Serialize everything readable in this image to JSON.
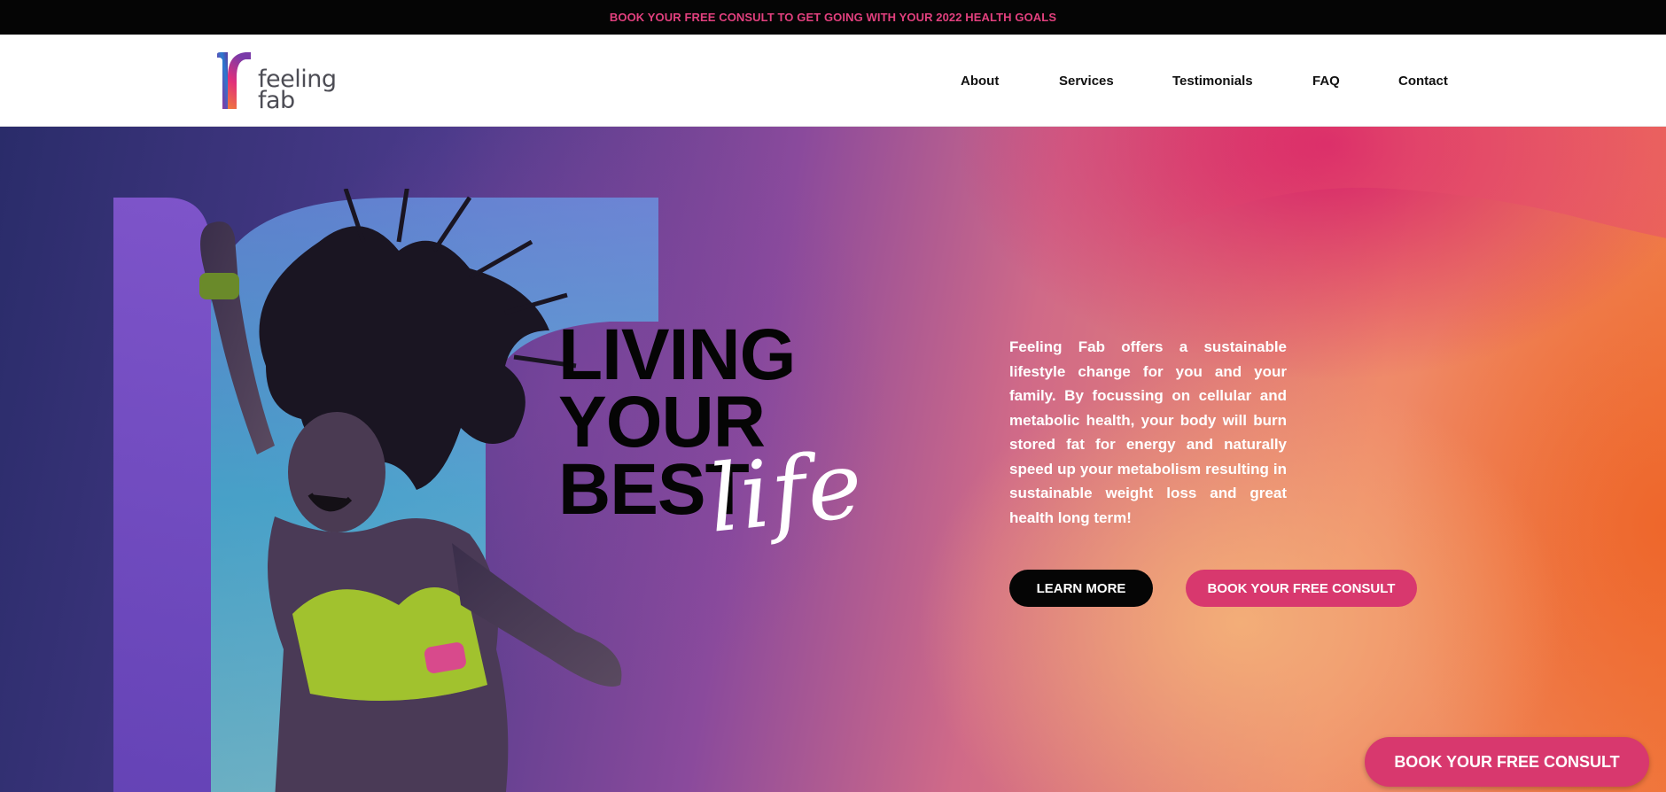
{
  "topbar": {
    "text": "BOOK YOUR FREE CONSULT TO GET GOING WITH YOUR 2022 HEALTH GOALS"
  },
  "brand": {
    "line1": "feeling",
    "line2": "fab"
  },
  "nav": {
    "items": [
      {
        "label": "About"
      },
      {
        "label": "Services"
      },
      {
        "label": "Testimonials"
      },
      {
        "label": "FAQ"
      },
      {
        "label": "Contact"
      }
    ]
  },
  "hero": {
    "headline_1": "LIVING",
    "headline_2": "YOUR",
    "headline_3": "BEST",
    "script": "life",
    "paragraph": "Feeling Fab offers a sustainable lifestyle change for you and your family. By focussing on cellular and metabolic health, your body will burn stored fat for energy and naturally speed up your metabolism resulting in sustainable weight loss and great health long term!",
    "learn_more_label": "LEARN MORE",
    "consult_label": "BOOK YOUR FREE CONSULT"
  },
  "floating": {
    "consult_label": "BOOK YOUR FREE CONSULT"
  },
  "colors": {
    "accent_pink": "#d8386e",
    "topbar_text": "#e2407e",
    "dark": "#050505"
  }
}
